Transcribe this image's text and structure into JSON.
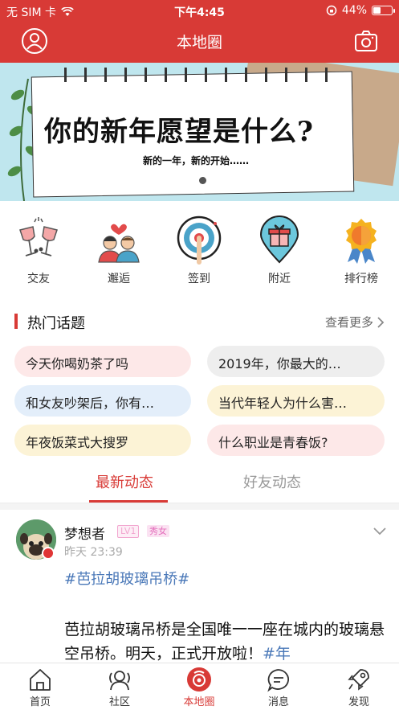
{
  "status_bar": {
    "carrier": "无 SIM 卡",
    "time": "下午4:45",
    "battery": "44%",
    "battery_level": 0.44
  },
  "header": {
    "title": "本地圈",
    "left_icon": "user-icon",
    "right_icon": "camera-icon"
  },
  "banner": {
    "title": "你的新年愿望是什么?",
    "subtitle": "新的一年，新的开始……"
  },
  "quick_menu": [
    {
      "label": "交友",
      "icon": "cheers-icon"
    },
    {
      "label": "邂逅",
      "icon": "couple-icon"
    },
    {
      "label": "签到",
      "icon": "checkin-icon"
    },
    {
      "label": "附近",
      "icon": "nearby-icon"
    },
    {
      "label": "排行榜",
      "icon": "medal-icon"
    }
  ],
  "hot_topics": {
    "title": "热门话题",
    "more": "查看更多",
    "items": [
      {
        "text": "今天你喝奶茶了吗",
        "color": "#fde8e8"
      },
      {
        "text": "2019年，你最大的…",
        "color": "#eeeeee"
      },
      {
        "text": "和女友吵架后，你有…",
        "color": "#e3eefa"
      },
      {
        "text": "当代年轻人为什么害…",
        "color": "#fcf3d6"
      },
      {
        "text": "年夜饭菜式大搜罗",
        "color": "#fcf3d6"
      },
      {
        "text": "什么职业是青春饭?",
        "color": "#fde8e8"
      }
    ]
  },
  "tabs": [
    {
      "label": "最新动态",
      "active": true
    },
    {
      "label": "好友动态",
      "active": false
    }
  ],
  "post": {
    "username": "梦想者",
    "level": "LV1",
    "gender_tag": "秀女",
    "time": "昨天 23:39",
    "hashtag": "#芭拉胡玻璃吊桥#",
    "text": "芭拉胡玻璃吊桥是全国唯一一座在城内的玻璃悬空吊桥。明天，正式开放啦！",
    "text_link": "#年"
  },
  "bottom_nav": [
    {
      "label": "首页",
      "icon": "home-icon"
    },
    {
      "label": "社区",
      "icon": "community-icon"
    },
    {
      "label": "本地圈",
      "icon": "local-circle-icon",
      "active": true
    },
    {
      "label": "消息",
      "icon": "message-icon"
    },
    {
      "label": "发现",
      "icon": "rocket-icon"
    }
  ],
  "colors": {
    "brand": "#d83a36",
    "link": "#4a78b8"
  }
}
